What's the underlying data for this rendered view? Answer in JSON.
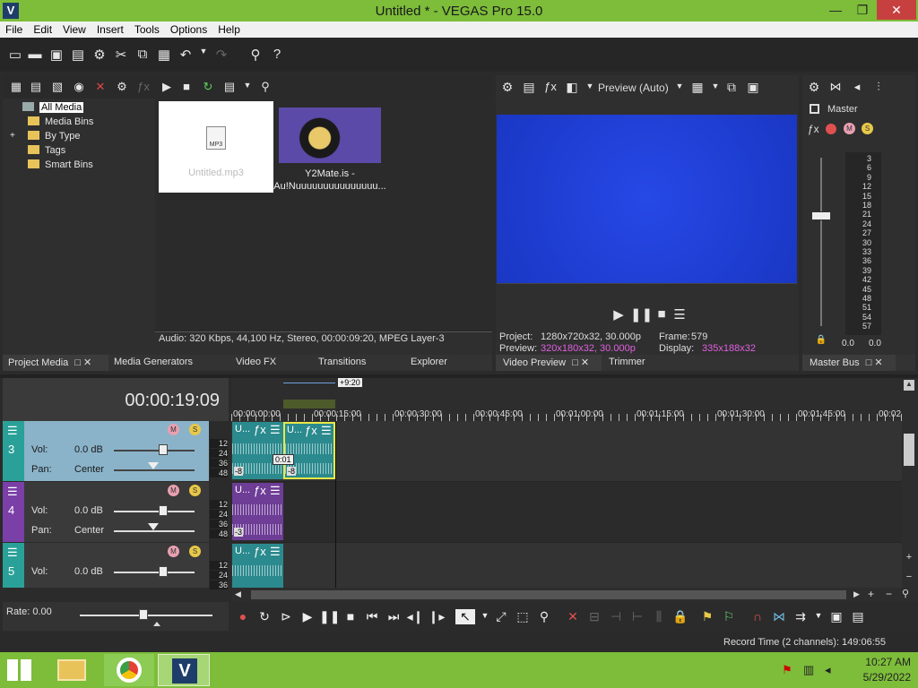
{
  "window": {
    "title": "Untitled * - VEGAS Pro 15.0",
    "logo": "V",
    "minimize": "—",
    "restore": "❐",
    "close": "✕"
  },
  "menu": [
    "File",
    "Edit",
    "View",
    "Insert",
    "Tools",
    "Options",
    "Help"
  ],
  "explorer": {
    "tree": [
      "All Media",
      "Media Bins",
      "By Type",
      "Tags",
      "Smart Bins"
    ],
    "expander": "+",
    "media": [
      {
        "name": "Untitled.mp3",
        "badge": "MP3"
      },
      {
        "name": "Y2Mate.is -",
        "name2": "Au!Nuuuuuuuuuuuuuuu..."
      }
    ],
    "status": "Audio: 320 Kbps, 44,100 Hz, Stereo, 00:00:09:20, MPEG Layer-3",
    "tabs": [
      "Project Media",
      "Media Generators",
      "Video FX",
      "Transitions",
      "Explorer"
    ]
  },
  "preview": {
    "mode": "Preview (Auto)",
    "project_label": "Project:",
    "project_value": "1280x720x32, 30.000p",
    "frame_label": "Frame:",
    "frame_value": "579",
    "preview_label": "Preview:",
    "preview_value": "320x180x32, 30.000p",
    "display_label": "Display:",
    "display_value": "335x188x32",
    "tabs": [
      "Video Preview",
      "Trimmer"
    ],
    "accent": "#1c3fd6"
  },
  "master": {
    "label": "Master",
    "scale": [
      "3",
      "6",
      "9",
      "12",
      "15",
      "18",
      "21",
      "24",
      "27",
      "30",
      "33",
      "36",
      "39",
      "42",
      "45",
      "48",
      "51",
      "54",
      "57"
    ],
    "left_value": "0.0",
    "right_value": "0.0",
    "tab": "Master Bus"
  },
  "timeline": {
    "timecode": "00:00:19:09",
    "offset_label": "+9:20",
    "ruler": [
      "00:00:00:00",
      "00:00:15:00",
      "00:00:30:00",
      "00:00:45:00",
      "00:01:00:00",
      "00:01:15:00",
      "00:01:30:00",
      "00:01:45:00",
      "00:02"
    ],
    "db_scale": [
      "12",
      "24",
      "36",
      "48"
    ],
    "tracks": [
      {
        "number": "3",
        "vol_label": "Vol:",
        "vol_value": "0.0 dB",
        "pan_label": "Pan:",
        "pan_value": "Center",
        "color": "#2aa198"
      },
      {
        "number": "4",
        "vol_label": "Vol:",
        "vol_value": "0.0 dB",
        "pan_label": "Pan:",
        "pan_value": "Center",
        "color": "#7b3fa8"
      },
      {
        "number": "5",
        "vol_label": "Vol:",
        "vol_value": "0.0 dB",
        "color": "#2aa198"
      }
    ],
    "clip_labels": {
      "short": "U...",
      "fade_a": "-8",
      "fade_b": "-8",
      "fade_c": "-3",
      "crossfade": "0:01"
    },
    "rate": "Rate: 0.00",
    "record_time": "Record Time (2 channels): 149:06:55"
  },
  "taskbar": {
    "time": "10:27 AM",
    "date": "5/29/2022"
  }
}
